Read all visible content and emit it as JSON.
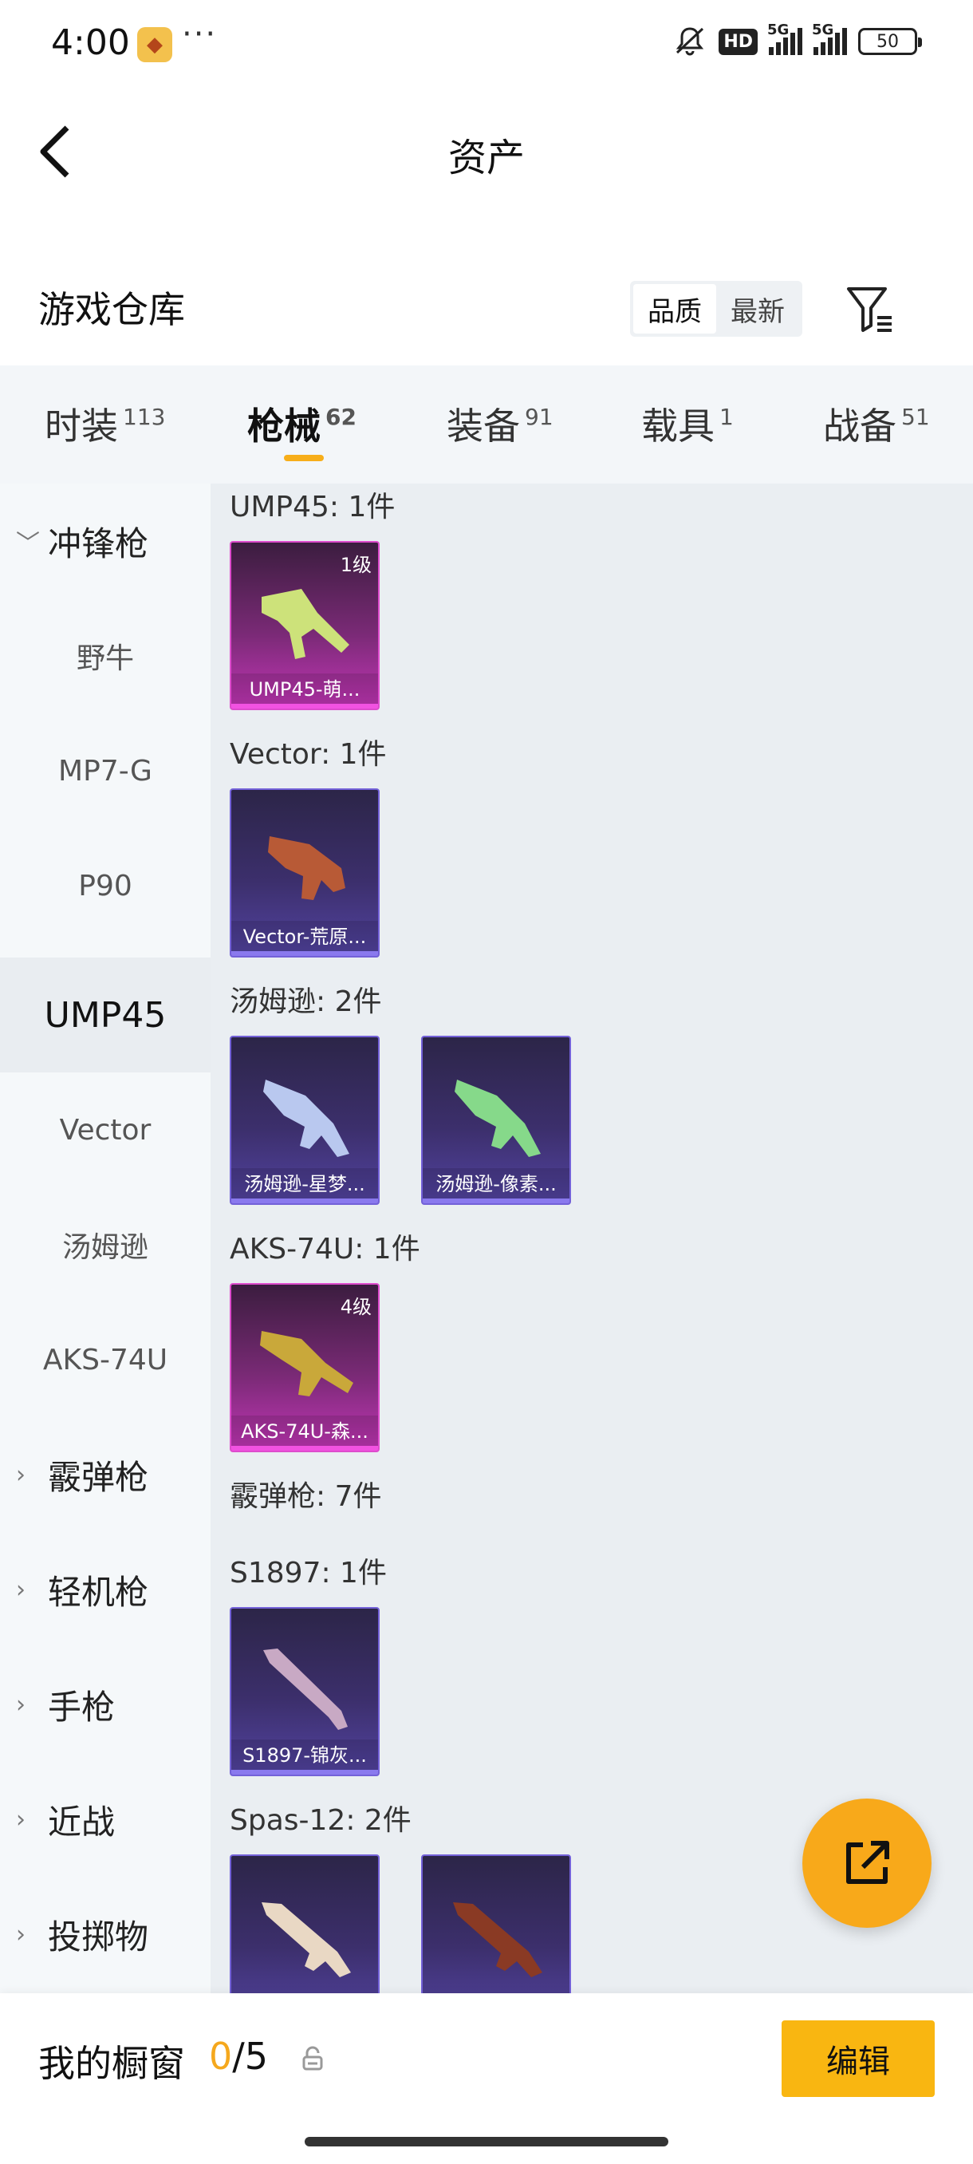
{
  "status": {
    "time": "4:00",
    "dots": "···",
    "hd": "HD",
    "network": [
      "5G",
      "5G"
    ],
    "battery": "50",
    "icons": [
      "app-notification-icon",
      "mute-icon"
    ]
  },
  "header": {
    "title": "资产"
  },
  "warehouse": {
    "title": "游戏仓库",
    "sort": [
      "品质",
      "最新"
    ],
    "sort_active": "品质"
  },
  "tabs": [
    {
      "label": "时装",
      "count": "113"
    },
    {
      "label": "枪械",
      "count": "62"
    },
    {
      "label": "装备",
      "count": "91"
    },
    {
      "label": "载具",
      "count": "1"
    },
    {
      "label": "战备",
      "count": "51"
    }
  ],
  "active_tab": "枪械",
  "sidebar": [
    {
      "label": "冲锋枪",
      "type": "group-open"
    },
    {
      "label": "野牛",
      "type": "item"
    },
    {
      "label": "MP7-G",
      "type": "item"
    },
    {
      "label": "P90",
      "type": "item"
    },
    {
      "label": "UMP45",
      "type": "item-active"
    },
    {
      "label": "Vector",
      "type": "item"
    },
    {
      "label": "汤姆逊",
      "type": "item"
    },
    {
      "label": "AKS-74U",
      "type": "item"
    },
    {
      "label": "霰弹枪",
      "type": "group"
    },
    {
      "label": "轻机枪",
      "type": "group"
    },
    {
      "label": "手枪",
      "type": "group"
    },
    {
      "label": "近战",
      "type": "group"
    },
    {
      "label": "投掷物",
      "type": "group"
    }
  ],
  "sections": [
    {
      "title": "UMP45: 1件",
      "cards": [
        {
          "name": "UMP45-萌...",
          "level": "1级",
          "rarity": "pink",
          "gun_color": "#cde27a"
        }
      ]
    },
    {
      "title": "Vector: 1件",
      "cards": [
        {
          "name": "Vector-荒原...",
          "level": "",
          "rarity": "purple",
          "gun_color": "#b85a36"
        }
      ]
    },
    {
      "title": "汤姆逊: 2件",
      "cards": [
        {
          "name": "汤姆逊-星梦...",
          "level": "",
          "rarity": "purple",
          "gun_color": "#b9c8ef"
        },
        {
          "name": "汤姆逊-像素...",
          "level": "",
          "rarity": "purple",
          "gun_color": "#86d98a"
        }
      ]
    },
    {
      "title": "AKS-74U: 1件",
      "cards": [
        {
          "name": "AKS-74U-森...",
          "level": "4级",
          "rarity": "pink",
          "gun_color": "#c9a83a"
        }
      ]
    },
    {
      "title": "霰弹枪: 7件",
      "cards": []
    },
    {
      "title": "S1897: 1件",
      "cards": [
        {
          "name": "S1897-锦灰...",
          "level": "",
          "rarity": "purple",
          "gun_color": "#c8a9c4"
        }
      ]
    },
    {
      "title": "Spas-12: 2件",
      "cards": [
        {
          "name": "",
          "level": "",
          "rarity": "purple",
          "gun_color": "#e9d8c4"
        },
        {
          "name": "",
          "level": "",
          "rarity": "purple",
          "gun_color": "#8a3a24"
        }
      ]
    }
  ],
  "showcase": {
    "label": "我的橱窗",
    "current": "0",
    "total": "/5"
  },
  "edit_label": "编辑",
  "colors": {
    "accent": "#f8a91a",
    "edit_button": "#f9b611",
    "pink_rarity": "#c236b6",
    "purple_rarity": "#5243a0"
  }
}
